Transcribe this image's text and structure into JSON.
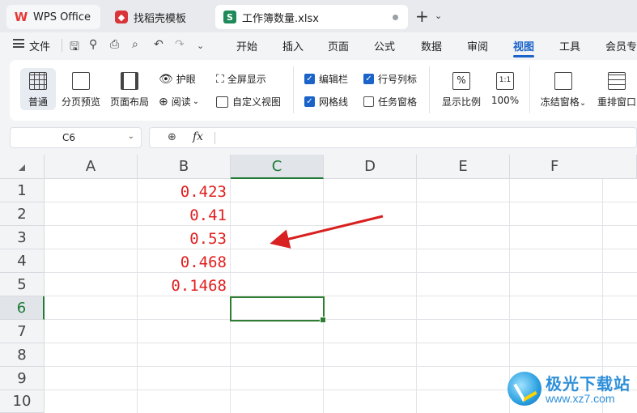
{
  "tabs": [
    {
      "label": "WPS Office",
      "icon": "wps-logo-icon"
    },
    {
      "label": "找稻壳模板",
      "icon": "docer-logo-icon"
    },
    {
      "label": "工作簿数量.xlsx",
      "icon": "spreadsheet-icon",
      "icon_letter": "S",
      "unsaved": true
    }
  ],
  "menubar": {
    "file_label": "文件",
    "menus": [
      "开始",
      "插入",
      "页面",
      "公式",
      "数据",
      "审阅",
      "视图",
      "工具",
      "会员专"
    ],
    "active_menu": "视图"
  },
  "ribbon": {
    "normal_label": "普通",
    "page_break_label": "分页预览",
    "page_layout_label": "页面布局",
    "eye_protection_label": "护眼",
    "reading_label": "阅读",
    "fullscreen_label": "全屏显示",
    "custom_view_label": "自定义视图",
    "formula_bar_label": "编辑栏",
    "formula_bar_checked": true,
    "headings_label": "行号列标",
    "headings_checked": true,
    "gridlines_label": "网格线",
    "gridlines_checked": true,
    "task_pane_label": "任务窗格",
    "task_pane_checked": false,
    "zoom_label": "显示比例",
    "zoom_icon_text": "%",
    "zoom100_icon_text": "1:1",
    "zoom100_label": "100%",
    "freeze_label": "冻结窗格",
    "arrange_label": "重排窗口"
  },
  "formula_bar": {
    "name_box": "C6",
    "fx_label": "fx",
    "formula": ""
  },
  "sheet": {
    "columns": [
      "A",
      "B",
      "C",
      "D",
      "E",
      "F"
    ],
    "rows": [
      "1",
      "2",
      "3",
      "4",
      "5",
      "6",
      "7",
      "8",
      "9",
      "10"
    ],
    "active_column": "C",
    "active_row": "6",
    "column_b_values": [
      "0.423",
      "0.41",
      "0.53",
      "0.468",
      "0.1468"
    ],
    "value_color": "#e02020"
  },
  "watermark": {
    "title": "极光下载站",
    "url": "www.xz7.com"
  },
  "colors": {
    "accent": "#1a63c9",
    "selection": "#2e7d32",
    "arrow": "#d92020"
  }
}
